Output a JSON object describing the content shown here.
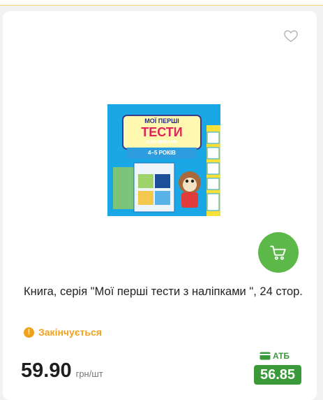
{
  "product": {
    "title": "Книга, серія \"Мої перші тести з наліпками \", 24 стор.",
    "stock_status": "Закінчується",
    "stock_icon": "!",
    "price": "59.90",
    "price_unit": "грн/шт",
    "loyalty_label": "АТБ",
    "loyalty_price": "56.85"
  },
  "cover": {
    "line1": "МОЇ ПЕРШІ",
    "line2": "ТЕСТИ",
    "line3": "З НАЛІПКАМИ",
    "age": "4–5 РОКІВ"
  },
  "colors": {
    "accent_green": "#5cb848",
    "loyalty_green": "#3a9a3a",
    "warning_orange": "#f0a21c",
    "cover_blue": "#1aa7e6"
  }
}
